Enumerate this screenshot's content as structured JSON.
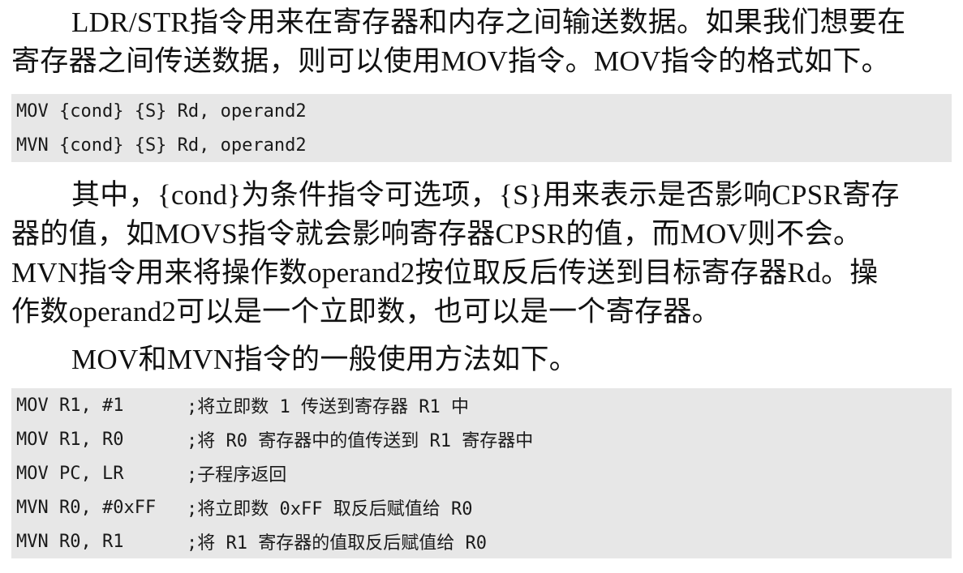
{
  "paragraph1": {
    "lines": [
      "LDR/STR指令用来在寄存器和内存之间输送数据。如果我们想要在",
      "寄存器之间传送数据，则可以使用MOV指令。MOV指令的格式如下。"
    ]
  },
  "syntax_block": {
    "lines": [
      "MOV {cond} {S} Rd, operand2",
      "MVN {cond} {S} Rd, operand2"
    ]
  },
  "paragraph2": {
    "lines": [
      "其中，{cond}为条件指令可选项，{S}用来表示是否影响CPSR寄存",
      "器的值，如MOVS指令就会影响寄存器CPSR的值，而MOV则不会。",
      "MVN指令用来将操作数operand2按位取反后传送到目标寄存器Rd。操",
      "作数operand2可以是一个立即数，也可以是一个寄存器。"
    ]
  },
  "paragraph3": {
    "lines": [
      "MOV和MVN指令的一般使用方法如下。"
    ]
  },
  "example_block": {
    "rows": [
      {
        "code": "MOV R1, #1",
        "comment": ";将立即数 1 传送到寄存器 R1 中"
      },
      {
        "code": "MOV R1, R0",
        "comment": ";将 R0 寄存器中的值传送到 R1 寄存器中"
      },
      {
        "code": "MOV PC, LR",
        "comment": ";子程序返回"
      },
      {
        "code": "MVN R0, #0xFF",
        "comment": ";将立即数 0xFF 取反后赋值给 R0"
      },
      {
        "code": "MVN R0, R1",
        "comment": ";将 R1 寄存器的值取反后赋值给 R0"
      }
    ]
  }
}
